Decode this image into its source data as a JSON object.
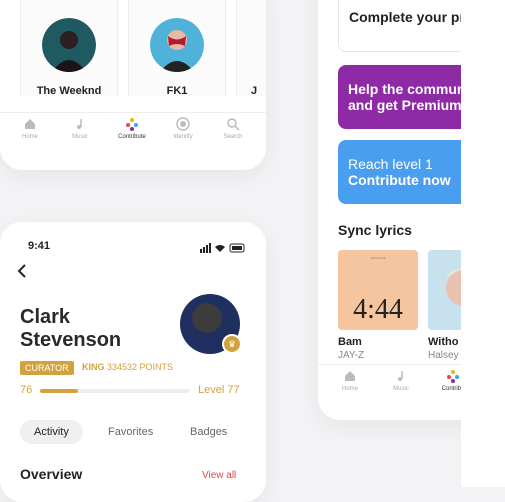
{
  "top_screen": {
    "artists": [
      {
        "name": "The Weeknd"
      },
      {
        "name": "FK1"
      },
      {
        "name": "J"
      }
    ],
    "tabbar": [
      {
        "label": "Home",
        "icon": "home-icon"
      },
      {
        "label": "Music",
        "icon": "music-note-icon"
      },
      {
        "label": "Contribute",
        "icon": "contribute-icon"
      },
      {
        "label": "Identify",
        "icon": "identify-icon"
      },
      {
        "label": "Search",
        "icon": "search-icon"
      }
    ]
  },
  "right_screen": {
    "promos": {
      "profile": "Complete your profile",
      "premium": "Help the community and get Premium",
      "level_line1": "Reach level 1",
      "level_line2": "Contribute now"
    },
    "section_title": "Sync lyrics",
    "lyrics": [
      {
        "title": "Bam",
        "artist": "JAY-Z",
        "cover_text": "4:44"
      },
      {
        "title": "Witho",
        "artist": "Halsey"
      }
    ],
    "tabbar": [
      {
        "label": "Home"
      },
      {
        "label": "Music"
      },
      {
        "label": "Contribu"
      }
    ]
  },
  "profile_screen": {
    "status_time": "9:41",
    "name_line1": "Clark",
    "name_line2": "Stevenson",
    "curator_label": "CURATOR",
    "rank_title": "KING",
    "rank_points": "334532 POINTS",
    "level_start": "76",
    "level_end": "Level 77",
    "level_progress": 0.25,
    "tabs": [
      "Activity",
      "Favorites",
      "Badges"
    ],
    "overview_label": "Overview",
    "view_all": "View all"
  },
  "colors": {
    "gold": "#d3a23e",
    "purple": "#8e2aa6",
    "blue": "#4a9ef0",
    "red": "#e04444"
  }
}
